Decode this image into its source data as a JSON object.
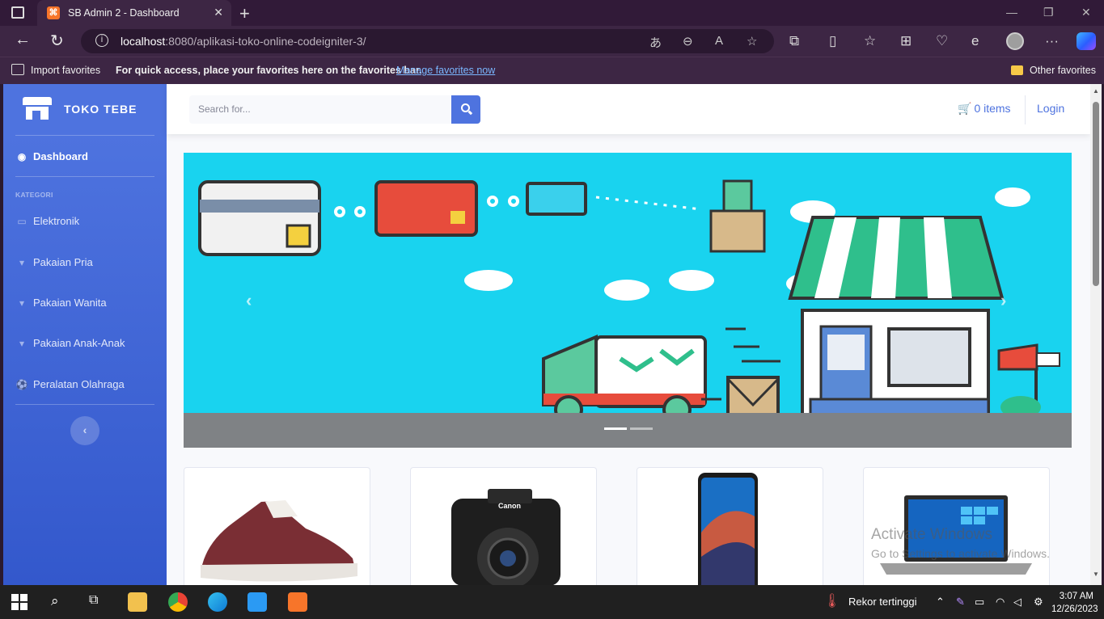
{
  "browser": {
    "tab_title": "SB Admin 2 - Dashboard",
    "url_host": "localhost",
    "url_rest": ":8080/aplikasi-toko-online-codeigniter-3/",
    "favorites": {
      "import": "Import favorites",
      "quick_access": "For quick access, place your favorites here on the favorites bar.",
      "manage": "Manage favorites now",
      "other": "Other favorites"
    }
  },
  "sidebar": {
    "brand": "TOKO TEBE",
    "dashboard": "Dashboard",
    "heading": "KATEGORI",
    "items": [
      {
        "label": "Elektronik",
        "icon": "desktop-icon"
      },
      {
        "label": "Pakaian Pria",
        "icon": "shirt-icon"
      },
      {
        "label": "Pakaian Wanita",
        "icon": "shirt-icon"
      },
      {
        "label": "Pakaian Anak-Anak",
        "icon": "shirt-icon"
      },
      {
        "label": "Peralatan Olahraga",
        "icon": "ball-icon"
      }
    ],
    "toggle": "‹"
  },
  "topbar": {
    "search_placeholder": "Search for...",
    "cart_label": "0 items",
    "login": "Login"
  },
  "watermark": {
    "title": "Activate Windows",
    "subtitle": "Go to Settings to activate Windows."
  },
  "taskbar": {
    "weather": "Rekor tertinggi",
    "time": "3:07 AM",
    "date": "12/26/2023"
  },
  "colors": {
    "primary": "#4e73df",
    "carousel_bg": "#19d3ef"
  }
}
